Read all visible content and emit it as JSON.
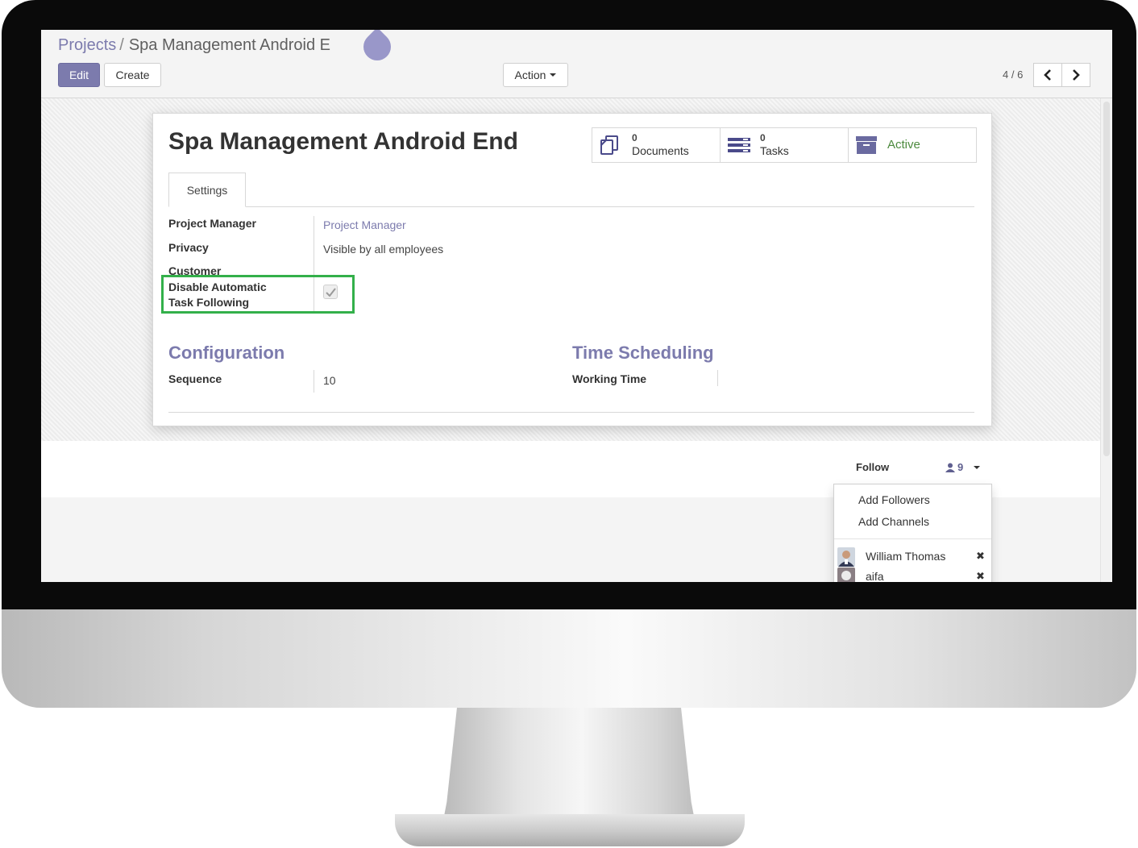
{
  "breadcrumb": {
    "parent": "Projects",
    "separator": "/",
    "current": "Spa Management Android E"
  },
  "toolbar": {
    "edit_label": "Edit",
    "create_label": "Create",
    "action_label": "Action"
  },
  "pager": {
    "value": "4 / 6"
  },
  "record": {
    "title": "Spa Management Android End"
  },
  "stat_buttons": {
    "documents": {
      "count": "0",
      "label": "Documents"
    },
    "tasks": {
      "count": "0",
      "label": "Tasks"
    },
    "active": {
      "label": "Active"
    }
  },
  "tabs": [
    {
      "label": "Settings"
    }
  ],
  "fields": {
    "project_manager": {
      "label": "Project Manager",
      "value": "Project Manager"
    },
    "privacy": {
      "label": "Privacy",
      "value": "Visible by all employees"
    },
    "customer": {
      "label": "Customer"
    },
    "disable_following": {
      "label_line1": "Disable Automatic",
      "label_line2": "Task Following",
      "checked": true
    }
  },
  "sections": {
    "configuration": {
      "title": "Configuration",
      "sequence_label": "Sequence",
      "sequence_value": "10"
    },
    "time_scheduling": {
      "title": "Time Scheduling",
      "working_time_label": "Working Time"
    }
  },
  "chatter": {
    "follow_label": "Follow",
    "followers_count": "9",
    "menu": {
      "add_followers": "Add Followers",
      "add_channels": "Add Channels"
    },
    "followers": [
      {
        "name": "William Thomas"
      },
      {
        "name": "aifa"
      }
    ]
  },
  "colors": {
    "brand": "#7c7bad",
    "highlight": "#33b04a",
    "active": "#4c8a3e"
  },
  "icons": [
    "documents-icon",
    "tasks-icon",
    "archive-icon",
    "caret-down-icon",
    "chevron-left-icon",
    "chevron-right-icon",
    "check-icon",
    "user-icon",
    "close-icon"
  ]
}
